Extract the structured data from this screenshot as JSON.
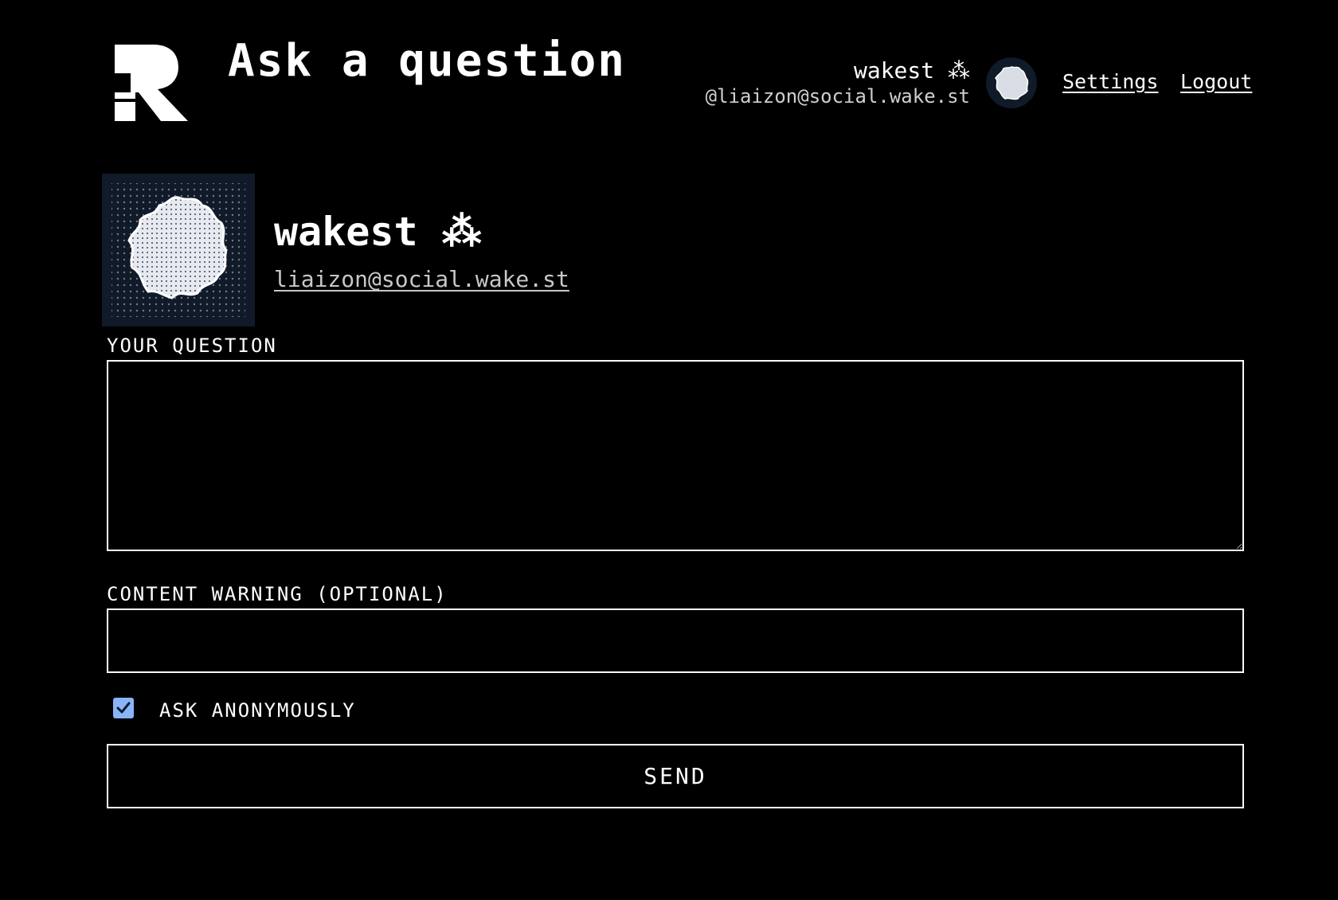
{
  "header": {
    "title": "Ask a question",
    "logo_icon": "r-logo-icon",
    "user": {
      "display_name": "wakest ⁂",
      "handle": "@liaizon@social.wake.st",
      "avatar_icon": "avatar-blob-icon"
    },
    "links": {
      "settings": "Settings",
      "logout": "Logout"
    }
  },
  "profile": {
    "name": "wakest ⁂",
    "handle": "liaizon@social.wake.st",
    "avatar_icon": "avatar-blob-icon"
  },
  "form": {
    "question_label": "YOUR QUESTION",
    "question_value": "",
    "cw_label": "CONTENT WARNING (OPTIONAL)",
    "cw_value": "",
    "anonymous_label": "ASK ANONYMOUSLY",
    "anonymous_checked": true,
    "send_label": "SEND"
  },
  "colors": {
    "background": "#000000",
    "text": "#ffffff",
    "muted": "#c8c8c8",
    "checkbox": "#8ab4f8",
    "avatar_bg": "#101a28"
  }
}
